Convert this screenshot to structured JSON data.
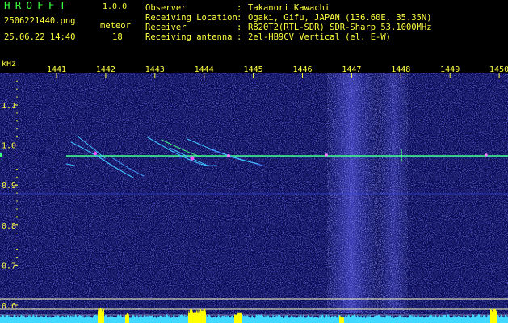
{
  "app": {
    "title": "HROFFT",
    "version": "1.0.0"
  },
  "file_name": "2506221440.png",
  "observation_time": "25.06.22 14:40",
  "meteor": {
    "label": "meteor",
    "count": "18"
  },
  "info": [
    {
      "label": "Observer",
      "value": "Takanori Kawachi"
    },
    {
      "label": "Receiving Location",
      "value": "Ogaki, Gifu, JAPAN (136.60E, 35.35N)"
    },
    {
      "label": "Receiver",
      "value": "R820T2(RTL-SDR) SDR-Sharp 53.1000MHz"
    },
    {
      "label": "Receiving antenna",
      "value": "2el-HB9CV Vertical (el. E-W)"
    }
  ],
  "axis": {
    "y_unit": "kHz",
    "x_ticks": [
      "1441",
      "1442",
      "1443",
      "1444",
      "1445",
      "1446",
      "1447",
      "1448",
      "1449",
      "1450"
    ],
    "y_ticks": [
      "1.1",
      "1.0",
      "0.9",
      "0.8",
      "0.7",
      "0.6"
    ]
  },
  "colors": {
    "header_text": "#ffff40",
    "title_green": "#3cff3c",
    "background": "#000000",
    "noise_blue": "#2222aa",
    "carrier": "#40ff80",
    "meteor_trace": "#40c0ff",
    "power_level": "#40d8ff",
    "power_peak": "#ffff00"
  }
}
